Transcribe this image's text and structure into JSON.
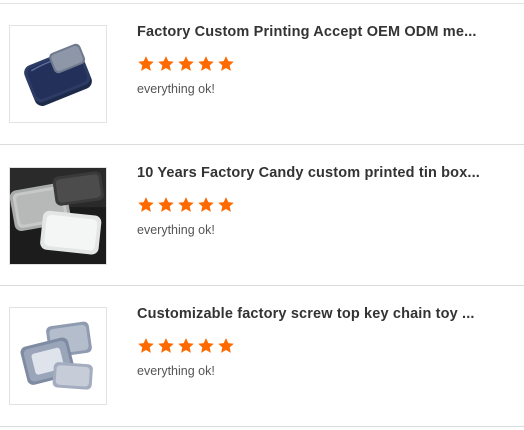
{
  "colors": {
    "star": "#ff6a00",
    "title": "#333333",
    "comment": "#555555",
    "divider": "#dcdcdc"
  },
  "reviews": [
    {
      "title": "Factory Custom Printing Accept OEM ODM me...",
      "rating": 5,
      "comment": "everything ok!",
      "thumbnail_icon": "navy-tin-box-image"
    },
    {
      "title": "10 Years Factory Candy custom printed tin box...",
      "rating": 5,
      "comment": "everything ok!",
      "thumbnail_icon": "silver-tin-boxes-image"
    },
    {
      "title": "Customizable factory screw top key chain toy ...",
      "rating": 5,
      "comment": "everything ok!",
      "thumbnail_icon": "window-tin-boxes-image"
    }
  ]
}
